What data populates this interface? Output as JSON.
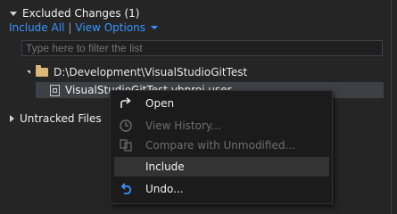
{
  "excluded": {
    "header": "Excluded Changes (1)",
    "include_all": "Include All",
    "separator": "|",
    "view_options": "View Options",
    "filter_placeholder": "Type here to filter the list",
    "folder_path": "D:\\Development\\VisualStudioGitTest",
    "file_name": "VisualStudioGitTest.vbproj.user"
  },
  "untracked": {
    "header": "Untracked Files"
  },
  "context_menu": {
    "items": [
      {
        "label": "Open",
        "enabled": true,
        "icon": "open-arrow-icon"
      },
      {
        "label": "View History...",
        "enabled": false,
        "icon": "history-clock-icon"
      },
      {
        "label": "Compare with Unmodified...",
        "enabled": false,
        "icon": "compare-icon"
      },
      {
        "label": "Include",
        "enabled": true,
        "icon": "none"
      },
      {
        "label": "Undo...",
        "enabled": true,
        "icon": "undo-arrow-icon"
      }
    ]
  },
  "colors": {
    "background": "#252526",
    "link": "#3794ff",
    "menu_background": "#1b1b1c",
    "menu_hover": "#333334"
  }
}
